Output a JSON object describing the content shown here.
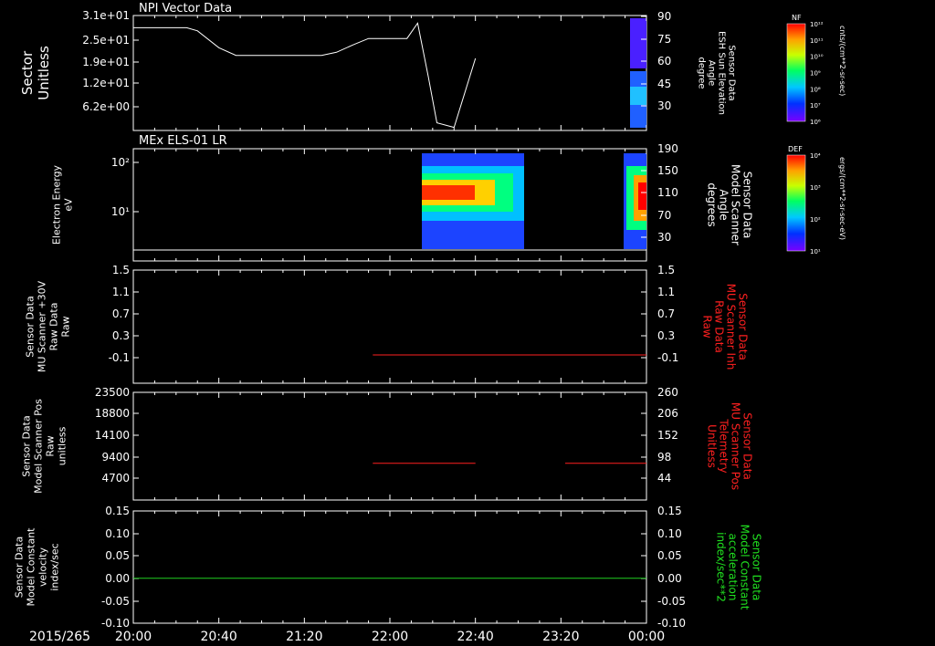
{
  "chart_data": [
    {
      "type": "line",
      "title": "NPI Vector Data",
      "ylabel_left": [
        "Sector",
        "Unitless"
      ],
      "yticks_left": [
        "3.1e+01",
        "2.5e+01",
        "1.9e+01",
        "1.2e+01",
        "6.2e+00"
      ],
      "ylabel_right": [
        "Sensor Data",
        "ESH Sun Elevation",
        "Angle",
        "degree"
      ],
      "yticks_right": [
        "90",
        "75",
        "60",
        "45",
        "30"
      ],
      "ylim_right": [
        15,
        90
      ],
      "series": [
        {
          "color": "#ffffff",
          "x_minutes": [
            0,
            25,
            30,
            40,
            48,
            80,
            88,
            95,
            103,
            110,
            120,
            128,
            133,
            138,
            142,
            150,
            160
          ],
          "values": [
            82,
            82,
            80,
            69,
            64,
            64,
            64,
            66,
            71,
            75,
            75,
            75,
            85,
            50,
            20,
            17,
            62
          ]
        }
      ],
      "colorbar": {
        "label": "NF",
        "unit": "cnts/(cm**2-sr-sec)",
        "ticks": [
          "10¹²",
          "10¹¹",
          "10¹⁰",
          "10⁹",
          "10⁸",
          "10⁷",
          "10⁶"
        ]
      }
    },
    {
      "type": "heatmap",
      "title": "MEx ELS-01 LR",
      "ylabel_left": [
        "Electron Energy",
        "eV"
      ],
      "yticks_left": [
        "10²",
        "10¹"
      ],
      "ylabel_right": [
        "Sensor Data",
        "Model Scanner",
        "Angle",
        "degrees"
      ],
      "yticks_right": [
        "190",
        "150",
        "110",
        "70",
        "30"
      ],
      "colorbar": {
        "label": "DEF",
        "unit": "ergs/(cm**2-sr-sec-eV)",
        "ticks": [
          "10⁴",
          "10³",
          "10²",
          "10¹"
        ]
      }
    },
    {
      "type": "line",
      "ylabel_left": [
        "Sensor Data",
        "MU Scanner +30V",
        "Raw Data",
        "Raw"
      ],
      "yticks_left": [
        "1.5",
        "1.1",
        "0.7",
        "0.3",
        "-0.1"
      ],
      "ylabel_right": [
        "Sensor Data",
        "MU Scanner Inh",
        "Raw Data",
        "Raw"
      ],
      "yticks_right": [
        "1.5",
        "1.1",
        "0.7",
        "0.3",
        "-0.1"
      ],
      "ylim": [
        -0.5,
        1.5
      ],
      "series": [
        {
          "color": "#ff2020",
          "x_minutes": [
            112,
            240
          ],
          "values": [
            0,
            0
          ]
        }
      ]
    },
    {
      "type": "line",
      "ylabel_left": [
        "Sensor Data",
        "Model Scanner Pos",
        "Raw",
        "unitless"
      ],
      "yticks_left": [
        "23500",
        "18800",
        "14100",
        "9400",
        "4700"
      ],
      "ylabel_right": [
        "Sensor Data",
        "MU Scanner Pos",
        "Telemetry",
        "Unitless"
      ],
      "yticks_right": [
        "260",
        "206",
        "152",
        "98",
        "44"
      ],
      "ylim": [
        0,
        23500
      ],
      "series": [
        {
          "color": "#ff2020",
          "x_minutes": [
            112,
            160
          ],
          "values": [
            8000,
            8000
          ]
        },
        {
          "color": "#ff2020",
          "x_minutes": [
            202,
            240
          ],
          "values": [
            8000,
            8000
          ]
        }
      ]
    },
    {
      "type": "line",
      "ylabel_left": [
        "Sensor Data",
        "Model Constant",
        "velocity",
        "index/sec"
      ],
      "yticks_left": [
        "0.15",
        "0.10",
        "0.05",
        "0.00",
        "-0.05",
        "-0.10"
      ],
      "ylabel_right": [
        "Sensor Data",
        "Model Constant",
        "acceleration",
        "index/sec**2"
      ],
      "yticks_right": [
        "0.15",
        "0.10",
        "0.05",
        "0.00",
        "-0.05",
        "-0.10"
      ],
      "ylim": [
        -0.1,
        0.15
      ],
      "series": [
        {
          "color": "#20d020",
          "x_minutes": [
            0,
            240
          ],
          "values": [
            0,
            0
          ]
        }
      ]
    }
  ],
  "x_axis": {
    "date_label": "2015/265",
    "ticks": [
      "20:00",
      "20:40",
      "21:20",
      "22:00",
      "22:40",
      "23:20",
      "00:00"
    ],
    "range_minutes": [
      0,
      240
    ]
  }
}
